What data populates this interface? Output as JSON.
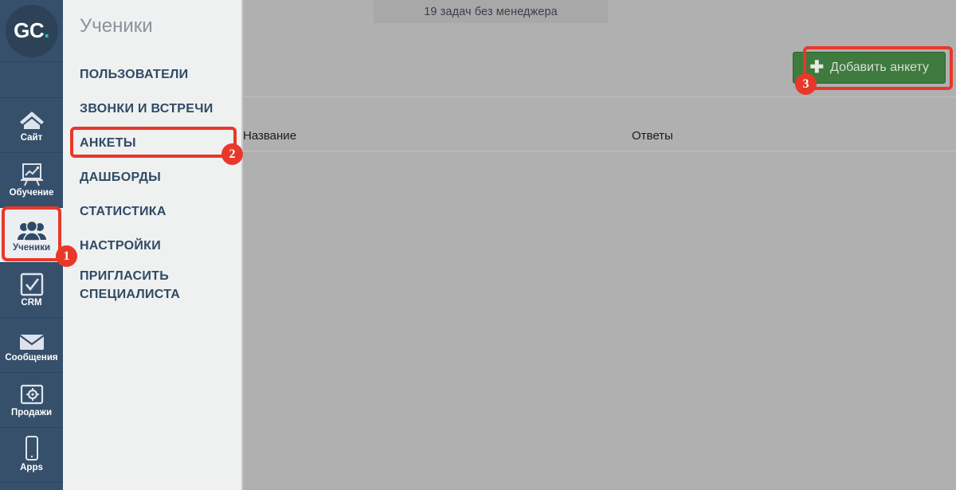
{
  "app": {
    "logo_g": "GC",
    "logo_c": "."
  },
  "rail": {
    "items": [
      {
        "label": "Сайт",
        "icon": "house-icon",
        "name": "site",
        "active": false
      },
      {
        "label": "Обучение",
        "icon": "chart-easel-icon",
        "name": "training",
        "active": false
      },
      {
        "label": "Ученики",
        "icon": "users-group-icon",
        "name": "students",
        "active": true
      },
      {
        "label": "CRM",
        "icon": "checkbox-icon",
        "name": "crm",
        "active": false
      },
      {
        "label": "Сообщения",
        "icon": "envelope-icon",
        "name": "messages",
        "active": false
      },
      {
        "label": "Продажи",
        "icon": "safe-icon",
        "name": "sales",
        "active": false
      },
      {
        "label": "Apps",
        "icon": "phone-icon",
        "name": "apps",
        "active": false
      }
    ]
  },
  "panel": {
    "title": "Ученики",
    "items": [
      {
        "label": "ПОЛЬЗОВАТЕЛИ",
        "name": "users"
      },
      {
        "label": "ЗВОНКИ И ВСТРЕЧИ",
        "name": "calls-and-meetings"
      },
      {
        "label": "АНКЕТЫ",
        "name": "forms"
      },
      {
        "label": "ДАШБОРДЫ",
        "name": "dashboards"
      },
      {
        "label": "СТАТИСТИКА",
        "name": "statistics"
      },
      {
        "label": "НАСТРОЙКИ",
        "name": "settings"
      },
      {
        "label": "ПРИГЛАСИТЬ СПЕЦИАЛИСТА",
        "name": "invite-specialist"
      }
    ]
  },
  "main": {
    "notification": "19 задач без менеджера",
    "add_button": {
      "label": "Добавить анкету",
      "icon": "plus-icon"
    },
    "table": {
      "columns": [
        "Название",
        "Ответы"
      ],
      "rows": []
    }
  },
  "annotations": {
    "markers": [
      {
        "number": "1",
        "target": "rail-item-students"
      },
      {
        "number": "2",
        "target": "menu-item-forms"
      },
      {
        "number": "3",
        "target": "add-form-button"
      }
    ],
    "color": "#e8382a"
  },
  "colors": {
    "rail_bg": "#36506b",
    "panel_bg": "#eff0f0",
    "content_bg": "#b0b0b0",
    "accent_green": "#3f7a3f",
    "highlight_red": "#e8382a",
    "logo_teal": "#23c5a8"
  }
}
